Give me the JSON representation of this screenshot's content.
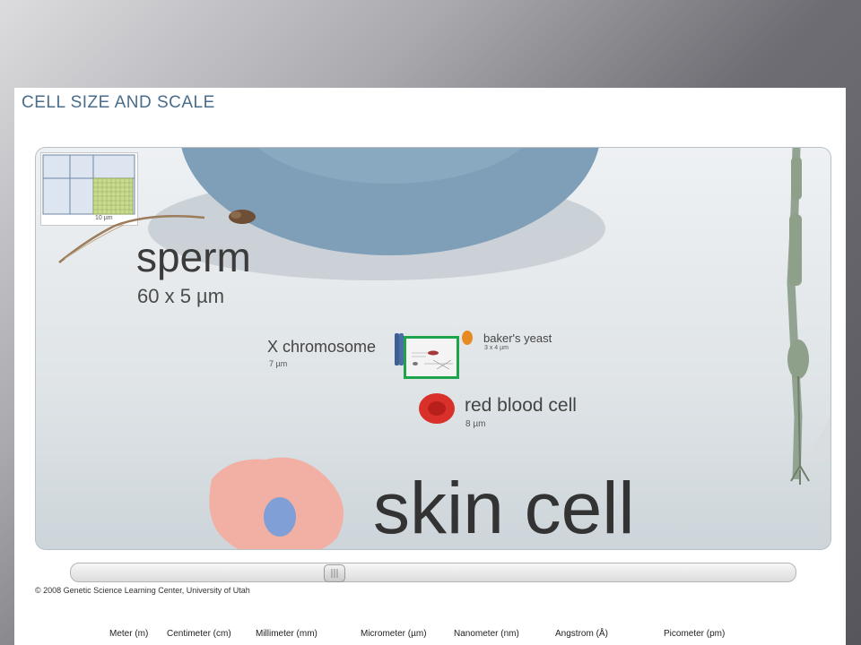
{
  "title": "CELL SIZE AND SCALE",
  "scale_inset": {
    "label": "10 µm"
  },
  "labels": {
    "sperm": {
      "name": "sperm",
      "size": "60 x 5 µm"
    },
    "x_chromosome": {
      "name": "X chromosome",
      "size": "7 µm"
    },
    "bakers_yeast": {
      "name": "baker's yeast",
      "size": "3 x 4 µm"
    },
    "red_blood_cell": {
      "name": "red blood cell",
      "size": "8 µm"
    },
    "skin_cell": {
      "name": "skin cell"
    }
  },
  "slider": {
    "position": 0.36
  },
  "copyright": "© 2008 Genetic Science Learning Center, University of Utah",
  "units": [
    "Meter (m)",
    "Centimeter (cm)",
    "Millimeter (mm)",
    "Micrometer (µm)",
    "Nanometer (nm)",
    "Angstrom (Å)",
    "Picometer (pm)"
  ],
  "colors": {
    "title": "#4a6d8c",
    "highlight": "#1ea44a",
    "rbc": "#d9302a",
    "yeast": "#e88a22",
    "skin": "#f2b0a4",
    "nucleus": "#7f9fd6"
  }
}
